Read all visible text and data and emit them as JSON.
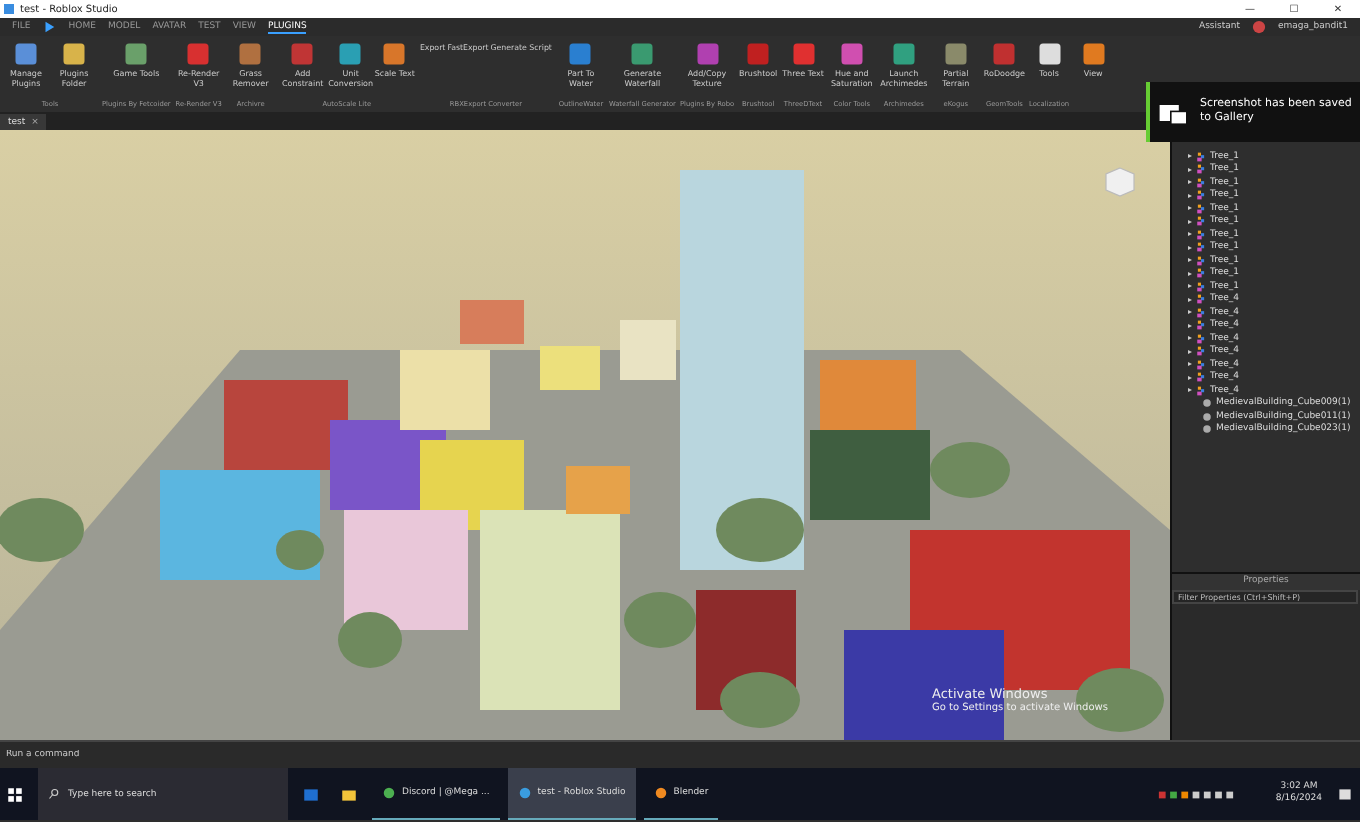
{
  "window": {
    "title": "test - Roblox Studio",
    "controls": [
      "—",
      "☐",
      "✕"
    ]
  },
  "menu": {
    "file": "FILE",
    "tabs": [
      {
        "label": "HOME",
        "selected": false
      },
      {
        "label": "MODEL",
        "selected": false
      },
      {
        "label": "AVATAR",
        "selected": false
      },
      {
        "label": "TEST",
        "selected": false
      },
      {
        "label": "VIEW",
        "selected": false
      },
      {
        "label": "PLUGINS",
        "selected": true
      }
    ],
    "assistant": "Assistant",
    "user": "emaga_bandit1"
  },
  "ribbon": [
    {
      "group": "Tools",
      "buttons": [
        "Manage Plugins",
        "Plugins Folder"
      ]
    },
    {
      "group": "Plugins By Fetcoider",
      "buttons": [
        "Game Tools"
      ]
    },
    {
      "group": "Re-Render V3",
      "buttons": [
        "Re-Render V3"
      ]
    },
    {
      "group": "Archivre",
      "buttons": [
        "Grass Remover"
      ]
    },
    {
      "group": "AutoScale Lite",
      "buttons": [
        "Add Constraint",
        "Unit Conversion",
        "Scale Text"
      ]
    },
    {
      "group": "RBXExport Converter",
      "small": [
        "Export",
        "FastExport",
        "Generate Script"
      ]
    },
    {
      "group": "OutlineWater",
      "buttons": [
        "Part To Water"
      ]
    },
    {
      "group": "Waterfall Generator",
      "buttons": [
        "Generate Waterfall"
      ]
    },
    {
      "group": "Plugins By Robo",
      "buttons": [
        "Add/Copy Texture"
      ]
    },
    {
      "group": "Brushtool",
      "buttons": [
        "Brushtool"
      ]
    },
    {
      "group": "ThreeDText",
      "buttons": [
        "Three Text"
      ]
    },
    {
      "group": "Color Tools",
      "buttons": [
        "Hue and Saturation"
      ]
    },
    {
      "group": "Archimedes",
      "buttons": [
        "Launch Archimedes"
      ]
    },
    {
      "group": "eKogus",
      "buttons": [
        "Partial Terrain"
      ]
    },
    {
      "group": "GeomTools",
      "buttons": [
        "RoDoodge"
      ]
    },
    {
      "group": "Localization",
      "buttons": [
        "Tools"
      ]
    },
    {
      "buttons": [
        "View"
      ]
    }
  ],
  "document_tab": {
    "label": "test",
    "close": "×"
  },
  "explorer": {
    "items": [
      {
        "name": "Tree_1",
        "expanded": false
      },
      {
        "name": "Tree_1",
        "expanded": false
      },
      {
        "name": "Tree_1",
        "expanded": false
      },
      {
        "name": "Tree_1",
        "expanded": false
      },
      {
        "name": "Tree_1",
        "expanded": false
      },
      {
        "name": "Tree_1",
        "expanded": false
      },
      {
        "name": "Tree_1",
        "expanded": false
      },
      {
        "name": "Tree_1",
        "expanded": false
      },
      {
        "name": "Tree_1",
        "expanded": false
      },
      {
        "name": "Tree_1",
        "expanded": false
      },
      {
        "name": "Tree_1",
        "expanded": false
      },
      {
        "name": "Tree_4",
        "expanded": false
      },
      {
        "name": "Tree_4",
        "expanded": false
      },
      {
        "name": "Tree_4",
        "expanded": false
      },
      {
        "name": "Tree_4",
        "expanded": false
      },
      {
        "name": "Tree_4",
        "expanded": false
      },
      {
        "name": "Tree_4",
        "expanded": false
      },
      {
        "name": "Tree_4",
        "expanded": false
      },
      {
        "name": "Tree_4",
        "expanded": false
      }
    ],
    "meshes": [
      "MedievalBuilding_Cube009(1)",
      "MedievalBuilding_Cube011(1)",
      "MedievalBuilding_Cube023(1)"
    ]
  },
  "properties": {
    "title": "Properties",
    "placeholder": "Filter Properties (Ctrl+Shift+P)"
  },
  "toast": {
    "message": "Screenshot has been saved to Gallery"
  },
  "activation": {
    "title": "Activate Windows",
    "text": "Go to Settings to activate Windows"
  },
  "command_bar": {
    "placeholder": "Run a command"
  },
  "taskbar": {
    "search": "Type here to search",
    "apps": [
      {
        "label": "Discord | @Mega ...",
        "selected": false
      },
      {
        "label": "test - Roblox Studio",
        "selected": true
      },
      {
        "label": "Blender",
        "selected": false
      }
    ],
    "time": "3:02 AM",
    "date": "8/16/2024"
  }
}
